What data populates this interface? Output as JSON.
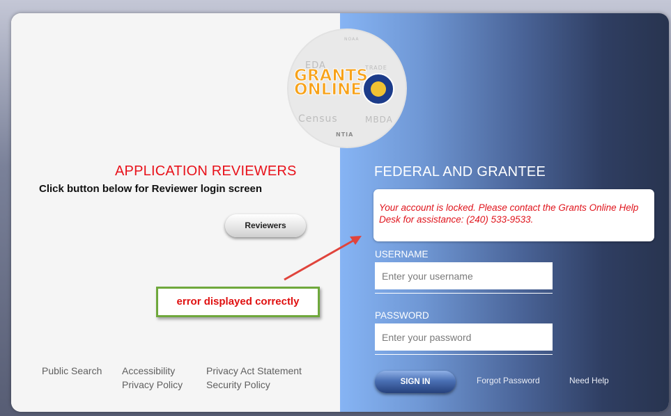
{
  "logo": {
    "name": "GRANTS ONLINE logo",
    "line1": "GRANTS",
    "line2": "ONLINE",
    "eda": "EDA",
    "trade": "TRADE",
    "census": "Census",
    "mbda": "MBDA",
    "ntia": "NTIA",
    "noaa": "NOAA"
  },
  "reviewers": {
    "title": "APPLICATION REVIEWERS",
    "subtitle": "Click button below for Reviewer login screen",
    "button_label": "Reviewers"
  },
  "annotation": {
    "text": "error displayed correctly"
  },
  "footer": {
    "public_search": "Public Search",
    "accessibility": "Accessibility",
    "privacy_policy": "Privacy Policy",
    "privacy_act": "Privacy Act Statement",
    "security_policy": "Security Policy"
  },
  "login": {
    "title": "FEDERAL AND GRANTEE",
    "error_message": "Your account is locked. Please contact the Grants Online Help Desk for assistance: (240) 533-9533.",
    "username_label": "USERNAME",
    "username_placeholder": "Enter your username",
    "password_label": "PASSWORD",
    "password_placeholder": "Enter your password",
    "signin_label": "SIGN IN",
    "forgot_password": "Forgot Password",
    "need_help": "Need Help"
  },
  "colors": {
    "accent_red": "#e8111a",
    "annotation_border": "#6fa83c",
    "logo_orange": "#f7a21a"
  }
}
